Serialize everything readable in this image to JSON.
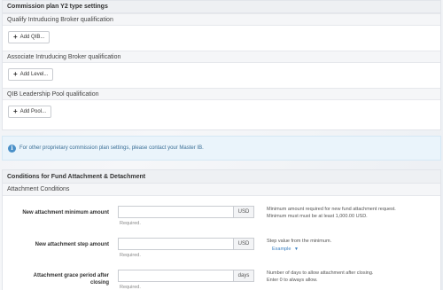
{
  "y2_panel": {
    "title": "Commission plan Y2 type settings",
    "sections": [
      {
        "title": "Qualify Intruducing Broker qualification",
        "button": "Add QIB..."
      },
      {
        "title": "Associate Intruducing Broker qualification",
        "button": "Add Level..."
      },
      {
        "title": "QIB Leadership Pool qualification",
        "button": "Add Pool..."
      }
    ]
  },
  "info_banner": {
    "icon": "info-icon",
    "text": "For other proprietary commission plan settings, please contact your Master IB."
  },
  "fund_panel": {
    "title": "Conditions for Fund Attachment & Detachment",
    "subtitle": "Attachment Conditions",
    "fields": [
      {
        "label": "New attachment minimum amount",
        "value": "",
        "unit": "USD",
        "required": "Required.",
        "help": [
          "Minimum amount required for new fund attachment request.",
          "Minimum must must be at least 1,000.00 USD."
        ]
      },
      {
        "label": "New attachment step amount",
        "value": "",
        "unit": "USD",
        "required": "Required.",
        "help": [
          "Step value from the minimum."
        ],
        "example": "Example"
      },
      {
        "label_lines": [
          "Attachment grace period after",
          "closing"
        ],
        "value": "",
        "unit": "days",
        "required": "Required.",
        "help": [
          "Number of days to allow attachment after closing.",
          "Enter 0 to always allow."
        ]
      }
    ]
  }
}
